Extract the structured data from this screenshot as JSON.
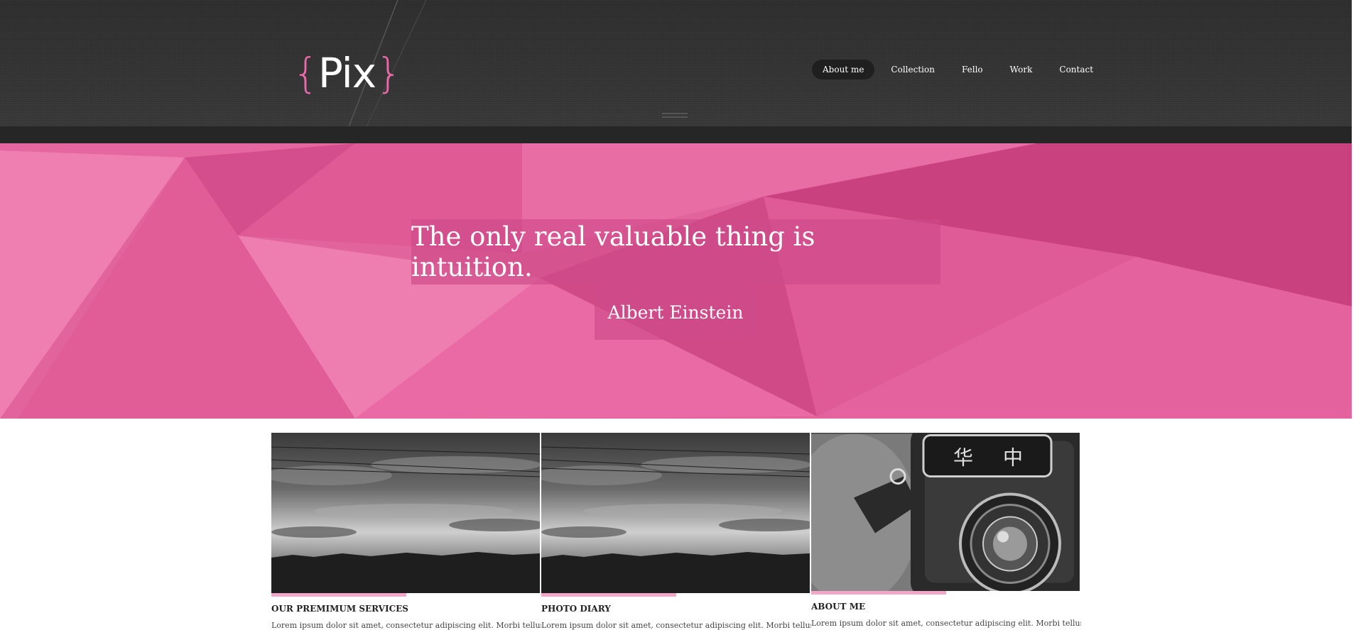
{
  "brand": {
    "name": "Pix",
    "brace_open": "{",
    "brace_close": "}",
    "accent_color": "#e96aa8"
  },
  "nav": {
    "items": [
      {
        "label": "About me",
        "active": true
      },
      {
        "label": "Collection",
        "active": false
      },
      {
        "label": "Fello",
        "active": false
      },
      {
        "label": "Work",
        "active": false
      },
      {
        "label": "Contact",
        "active": false
      }
    ],
    "menu_icon": "hamburger-icon"
  },
  "hero": {
    "quote": "The only real valuable thing is intuition.",
    "author": "Albert Einstein",
    "background_color": "#e06098"
  },
  "cards": [
    {
      "title": "OUR PREMIMUM SERVICES",
      "text": "Lorem ipsum dolor sit amet, consectetur adipiscing elit. Morbi tellus",
      "image": "sky-photo"
    },
    {
      "title": "PHOTO DIARY",
      "text": "Lorem ipsum dolor sit amet, consectetur adipiscing elit. Morbi tellus",
      "image": "sky-photo"
    },
    {
      "title": "ABOUT ME",
      "text": "Lorem ipsum dolor sit amet, consectetur adipiscing elit. Morbi tellus",
      "image": "camera-photo"
    }
  ]
}
